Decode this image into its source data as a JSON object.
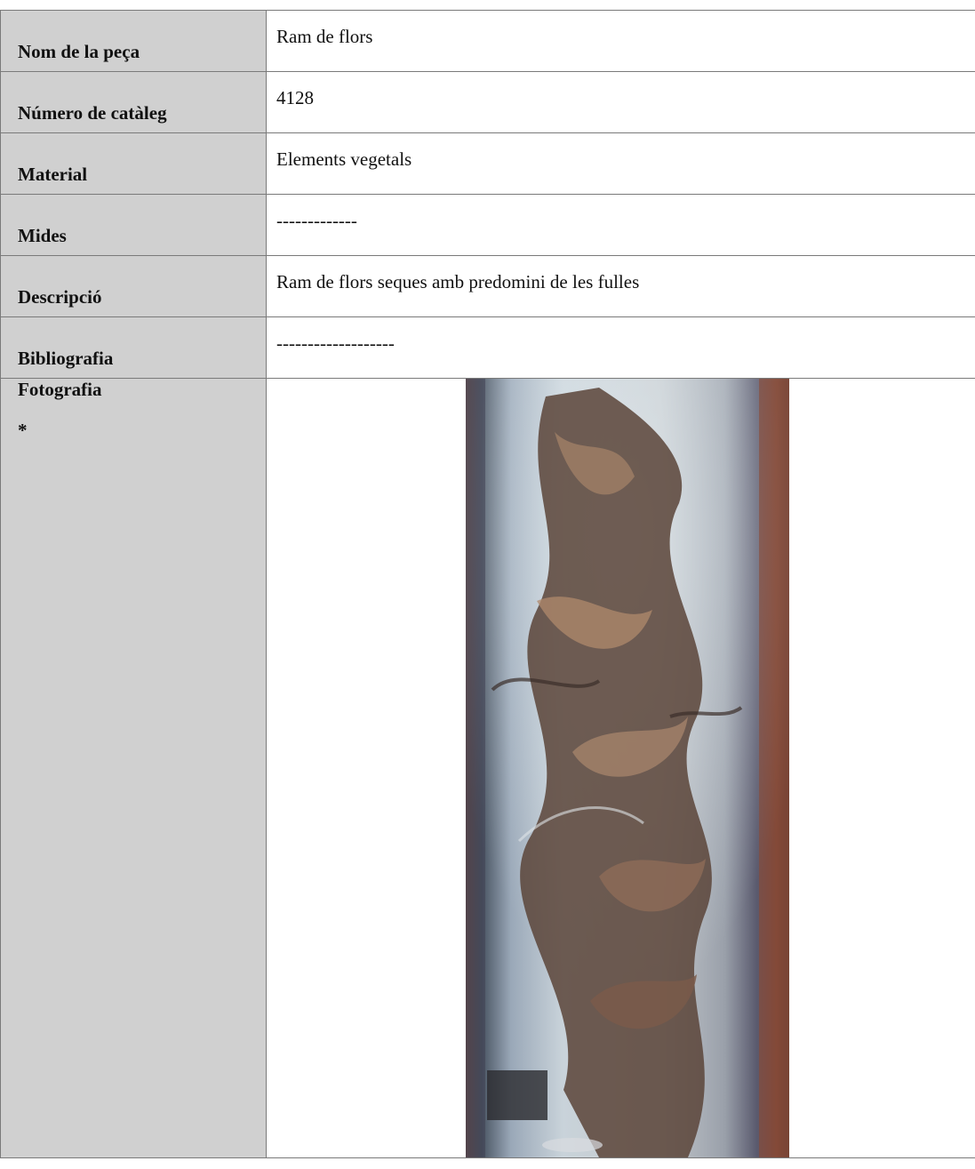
{
  "rows": [
    {
      "label": "Nom de la peça",
      "value": "Ram de flors"
    },
    {
      "label": "Número de catàleg",
      "value": "4128"
    },
    {
      "label": "Material",
      "value": "Elements vegetals"
    },
    {
      "label": "Mides",
      "value": "-------------"
    },
    {
      "label": "Descripció",
      "value": "Ram de flors seques amb predomini de les fulles"
    },
    {
      "label": "Bibliografia",
      "value": "-------------------"
    }
  ],
  "photo": {
    "label": "Fotografia",
    "asterisk": "*",
    "image_icon": "dried-flower-bouquet-photo"
  },
  "colors": {
    "label_bg": "#d0d0d0",
    "border": "#7a7a7a"
  }
}
